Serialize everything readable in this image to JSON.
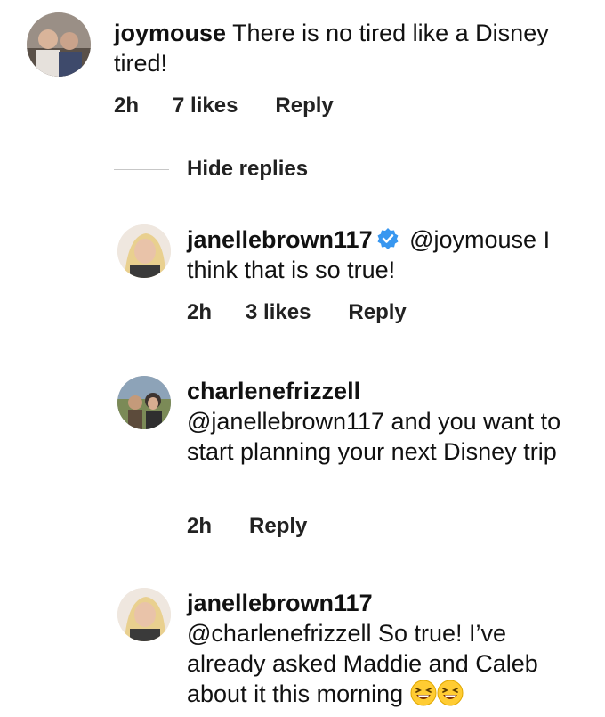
{
  "comments": [
    {
      "username": "joymouse",
      "text": "There is no tired like a Disney tired!",
      "time": "2h",
      "likes": "7 likes",
      "reply": "Reply"
    },
    {
      "username": "janellebrown117",
      "verified": true,
      "text": "@joymouse I think that is so true!",
      "time": "2h",
      "likes": "3 likes",
      "reply": "Reply"
    },
    {
      "username": "charlenefrizzell",
      "text": "@janellebrown117 and you want to start planning your next Disney trip",
      "time": "2h",
      "reply": "Reply"
    },
    {
      "username": "janellebrown117",
      "text": "@charlenefrizzell So true!  I’ve already asked Maddie and Caleb about it this morning",
      "emoji": [
        "grinning-squinting-face",
        "grinning-squinting-face"
      ]
    }
  ],
  "thread": {
    "hide_replies_label": "Hide replies"
  },
  "colors": {
    "text": "#111111",
    "verified_badge": "#3897f0",
    "divider": "#c7c7c7"
  },
  "icons": [
    "verified-badge-icon",
    "grinning-squinting-face-icon"
  ]
}
